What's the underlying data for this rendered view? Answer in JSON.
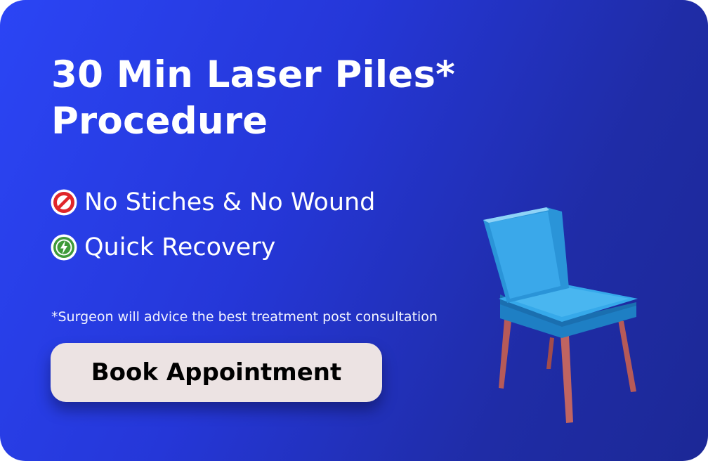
{
  "promo": {
    "title_line1": "30 Min Laser Piles*",
    "title_line2": "Procedure",
    "features": [
      {
        "icon": "no-entry-icon",
        "label": "No Stiches & No Wound"
      },
      {
        "icon": "lightning-icon",
        "label": "Quick Recovery"
      }
    ],
    "disclaimer": "*Surgeon will advice the best treatment post consultation",
    "cta_label": "Book Appointment",
    "illustration": "chair-icon"
  },
  "colors": {
    "background_start": "#2b45f5",
    "background_end": "#1c2896",
    "button_bg": "#ece3e3",
    "no_entry_red": "#e0262b",
    "quick_green": "#3f9a3a",
    "chair_blue": "#2fa0e6",
    "chair_legs": "#b65a58"
  }
}
